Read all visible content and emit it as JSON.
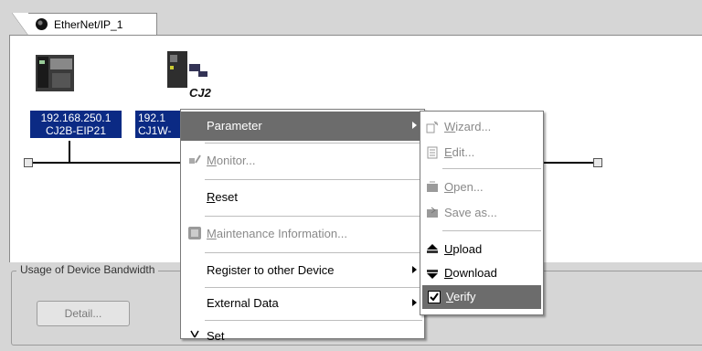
{
  "tab": {
    "label": "EtherNet/IP_1",
    "icon": "network-globe-icon"
  },
  "devices": [
    {
      "ip": "192.168.250.1",
      "model": "CJ2B-EIP21"
    },
    {
      "ip": "192.1",
      "model": "CJ1W-",
      "badge": "CJ2"
    }
  ],
  "usage": {
    "title": "Usage of Device Bandwidth",
    "detail_label": "Detail..."
  },
  "context_menu": {
    "items": [
      {
        "label": "Parameter",
        "selected": true,
        "submenu": true
      },
      {
        "label": "Monitor...",
        "disabled": true,
        "icon": "monitor-icon"
      },
      {
        "label": "Reset"
      },
      {
        "label": "Maintenance Information...",
        "disabled": true,
        "icon": "maintenance-icon"
      },
      {
        "label": "Register to other Device",
        "submenu": true
      },
      {
        "label": "External Data",
        "submenu": true
      },
      {
        "label": "Set",
        "partial": true
      }
    ]
  },
  "submenu": {
    "items": [
      {
        "label": "Wizard...",
        "disabled": true,
        "icon": "wizard-icon"
      },
      {
        "label": "Edit...",
        "disabled": true,
        "icon": "edit-icon"
      },
      {
        "label": "Open...",
        "disabled": true,
        "icon": "open-icon"
      },
      {
        "label": "Save as...",
        "disabled": true,
        "icon": "save-icon"
      },
      {
        "label": "Upload",
        "icon": "upload-icon"
      },
      {
        "label": "Download",
        "icon": "download-icon"
      },
      {
        "label": "Verify",
        "selected": true,
        "icon": "check-icon"
      }
    ]
  },
  "colors": {
    "selection": "#6c6c6c",
    "device_label_bg": "#0b2a84",
    "canvas": "#ffffff"
  }
}
